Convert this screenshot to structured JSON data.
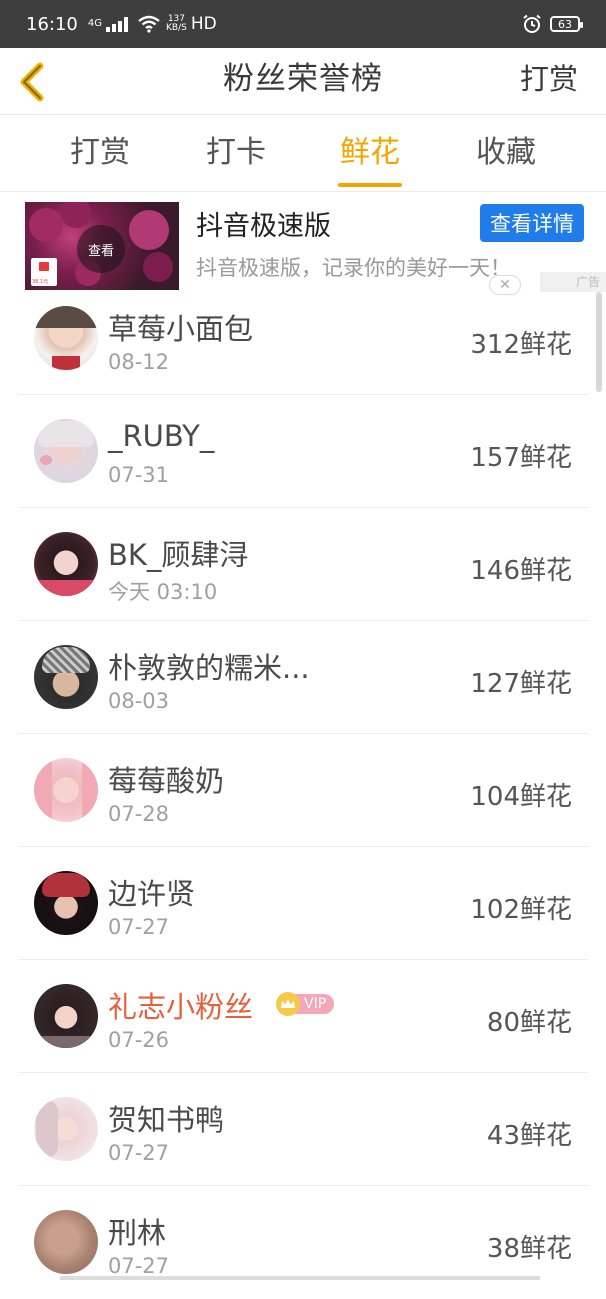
{
  "status_bar": {
    "time": "16:10",
    "network": "4G",
    "speed_top": "137",
    "speed_unit": "KB/S",
    "hd": "HD",
    "battery": "63"
  },
  "header": {
    "title": "粉丝荣誉榜",
    "action": "打赏"
  },
  "tabs": [
    {
      "label": "打赏",
      "active": false
    },
    {
      "label": "打卡",
      "active": false
    },
    {
      "label": "鲜花",
      "active": true
    },
    {
      "label": "收藏",
      "active": false
    }
  ],
  "ad": {
    "title": "抖音极速版",
    "button": "查看详情",
    "description": "抖音极速版，记录你的美好一天！",
    "thumb_badge": "查看",
    "thumb_price": "38.1元",
    "label": "广告"
  },
  "rankings": [
    {
      "name": "草莓小面包",
      "date": "08-12",
      "count": "312鲜花",
      "vip": false
    },
    {
      "name": "_RUBY_",
      "date": "07-31",
      "count": "157鲜花",
      "vip": false
    },
    {
      "name": "BK_顾肆浔",
      "date": "今天 03:10",
      "count": "146鲜花",
      "vip": false
    },
    {
      "name": "朴敦敦的糯米...",
      "date": "08-03",
      "count": "127鲜花",
      "vip": false
    },
    {
      "name": "莓莓酸奶",
      "date": "07-28",
      "count": "104鲜花",
      "vip": false
    },
    {
      "name": "边许贤",
      "date": "07-27",
      "count": "102鲜花",
      "vip": false
    },
    {
      "name": "礼志小粉丝",
      "date": "07-26",
      "count": "80鲜花",
      "vip": true,
      "vip_label": "VIP"
    },
    {
      "name": "贺知书鸭",
      "date": "07-27",
      "count": "43鲜花",
      "vip": false
    },
    {
      "name": "刑林",
      "date": "07-27",
      "count": "38鲜花",
      "vip": false
    }
  ],
  "colors": {
    "accent": "#f5a400",
    "vip_name": "#e8603b",
    "ad_button": "#1f7ce8"
  }
}
